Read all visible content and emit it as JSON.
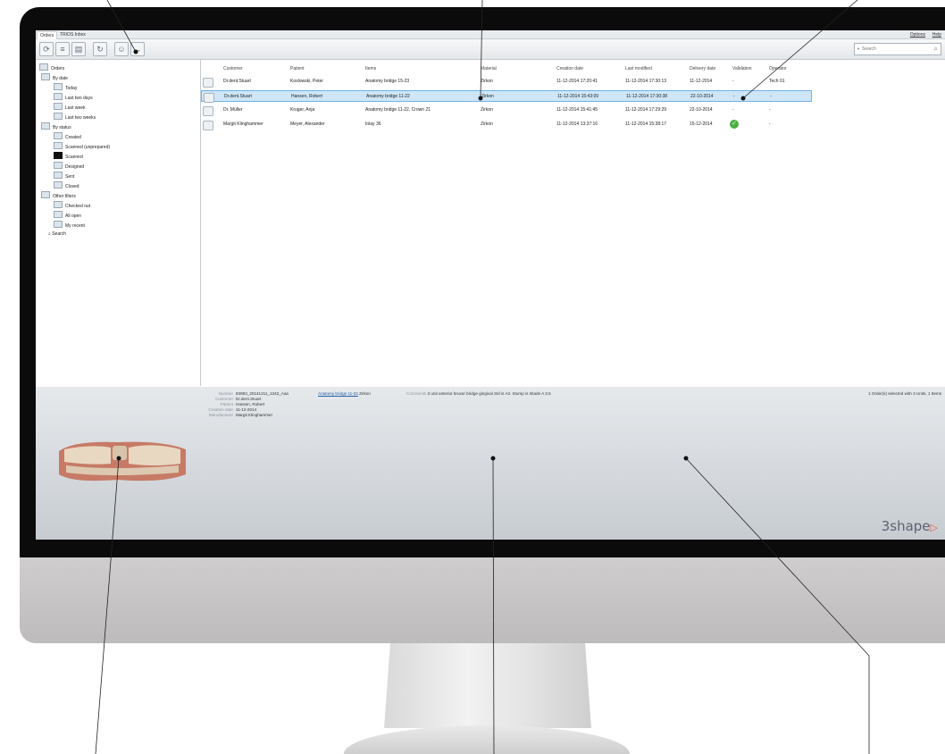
{
  "app": {
    "tabs": [
      "Orders",
      "TRIOS Inbox"
    ],
    "menu": {
      "options": "Options",
      "help": "Help"
    }
  },
  "toolbar": {
    "icons": [
      "refresh-icon",
      "stack-icon",
      "open-icon",
      "sync-icon",
      "user-icon",
      "compare-icon"
    ],
    "search_placeholder": "Search"
  },
  "tree": {
    "root": "Orders",
    "by_date": {
      "label": "By date",
      "items": [
        "Today",
        "Last two days",
        "Last week",
        "Last two weeks"
      ]
    },
    "by_status": {
      "label": "By status",
      "items": [
        "Created",
        "Scanned (unprepared)",
        "Scanned",
        "Designed",
        "Sent",
        "Closed"
      ]
    },
    "other": {
      "label": "Other filters",
      "items": [
        "Checked out",
        "All open",
        "My recent"
      ]
    },
    "search": "Search"
  },
  "grid": {
    "headers": [
      "Customer",
      "Patient",
      "Items",
      "Material",
      "Creation date",
      "Last modified",
      "Delivery date",
      "Validation",
      "Operator"
    ],
    "rows": [
      [
        "Dr.dent.Stuart",
        "Koslowski, Peter",
        "Anatomy bridge 15-23",
        "Zirkon",
        "11-12-2014 17:20:41",
        "11-12-2014 17:30:13",
        "11-12-2014",
        "-",
        "Tech 01"
      ],
      [
        "Dr.dent.Stuart",
        "Hansen, Robert",
        "Anatomy bridge 11-22",
        "Zirkon",
        "11-12-2014 15:43:09",
        "11-12-2014 17:30:38",
        "22-10-2014",
        "-",
        "-"
      ],
      [
        "Dr. Müller",
        "Kruger, Anja",
        "Anatomy bridge 11-22, Crown 21",
        "Zirkon",
        "11-12-2014 15:41:45",
        "11-12-2014 17:29:29",
        "22-10-2014",
        "-",
        "-"
      ],
      [
        "Margit Klinghammer",
        "Meyer, Alexander",
        "Inlay 36",
        "Zirkon",
        "11-12-2014 13:37:16",
        "11-12-2014 15:38:17",
        "15-12-2014",
        "",
        "-"
      ]
    ],
    "selected_row": 1,
    "validated_row": 3
  },
  "detail": {
    "labels": [
      "Number",
      "Customer",
      "Patient",
      "Creation date",
      "Manufacturer"
    ],
    "values": [
      "83983_20141211_1343_Aaa",
      "Dr.dent.Stuart",
      "Hansen, Robert",
      "11-12-2014",
      "Margit Klinghammer"
    ],
    "item_link": "Anatomy bridge 11-22",
    "item_material": "Zirkon",
    "comments_label": "Comments",
    "comments": "3 unit anterior bruxor bridge gingival 3rd is A3. Stump is shade A 3.5",
    "summary": "1 Order(s) selected with 3 Units, 1 Items"
  },
  "brand": {
    "logo_text": "3shape",
    "accent": "#e4574c"
  },
  "colors": {
    "selection": "#cfe6f8",
    "selection_border": "#6fb2e4",
    "check": "#4caf3f"
  }
}
